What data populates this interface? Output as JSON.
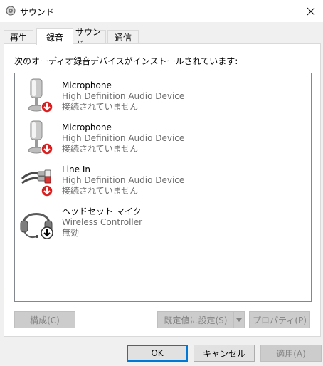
{
  "window": {
    "title": "サウンド"
  },
  "tabs": [
    {
      "label": "再生"
    },
    {
      "label": "録音"
    },
    {
      "label": "サウンド"
    },
    {
      "label": "通信"
    }
  ],
  "panel": {
    "heading": "次のオーディオ録音デバイスがインストールされています:"
  },
  "devices": [
    {
      "name": "Microphone",
      "driver": "High Definition Audio Device",
      "status": "接続されていません",
      "icon": "microphone-icon",
      "badge": "red-down-arrow"
    },
    {
      "name": "Microphone",
      "driver": "High Definition Audio Device",
      "status": "接続されていません",
      "icon": "microphone-icon",
      "badge": "red-down-arrow"
    },
    {
      "name": "Line In",
      "driver": "High Definition Audio Device",
      "status": "接続されていません",
      "icon": "line-in-cable-icon",
      "badge": "red-down-arrow"
    },
    {
      "name": "ヘッドセット マイク",
      "driver": "Wireless Controller",
      "status": "無効",
      "icon": "headset-icon",
      "badge": "black-down-arrow"
    }
  ],
  "buttons": {
    "configure": "構成(C)",
    "set_default": "既定値に設定(S)",
    "properties": "プロパティ(P)",
    "ok": "OK",
    "cancel": "キャンセル",
    "apply": "適用(A)"
  },
  "colors": {
    "accent": "#0078d7",
    "badge_red": "#d81e1e",
    "disabled_text": "#838383"
  }
}
